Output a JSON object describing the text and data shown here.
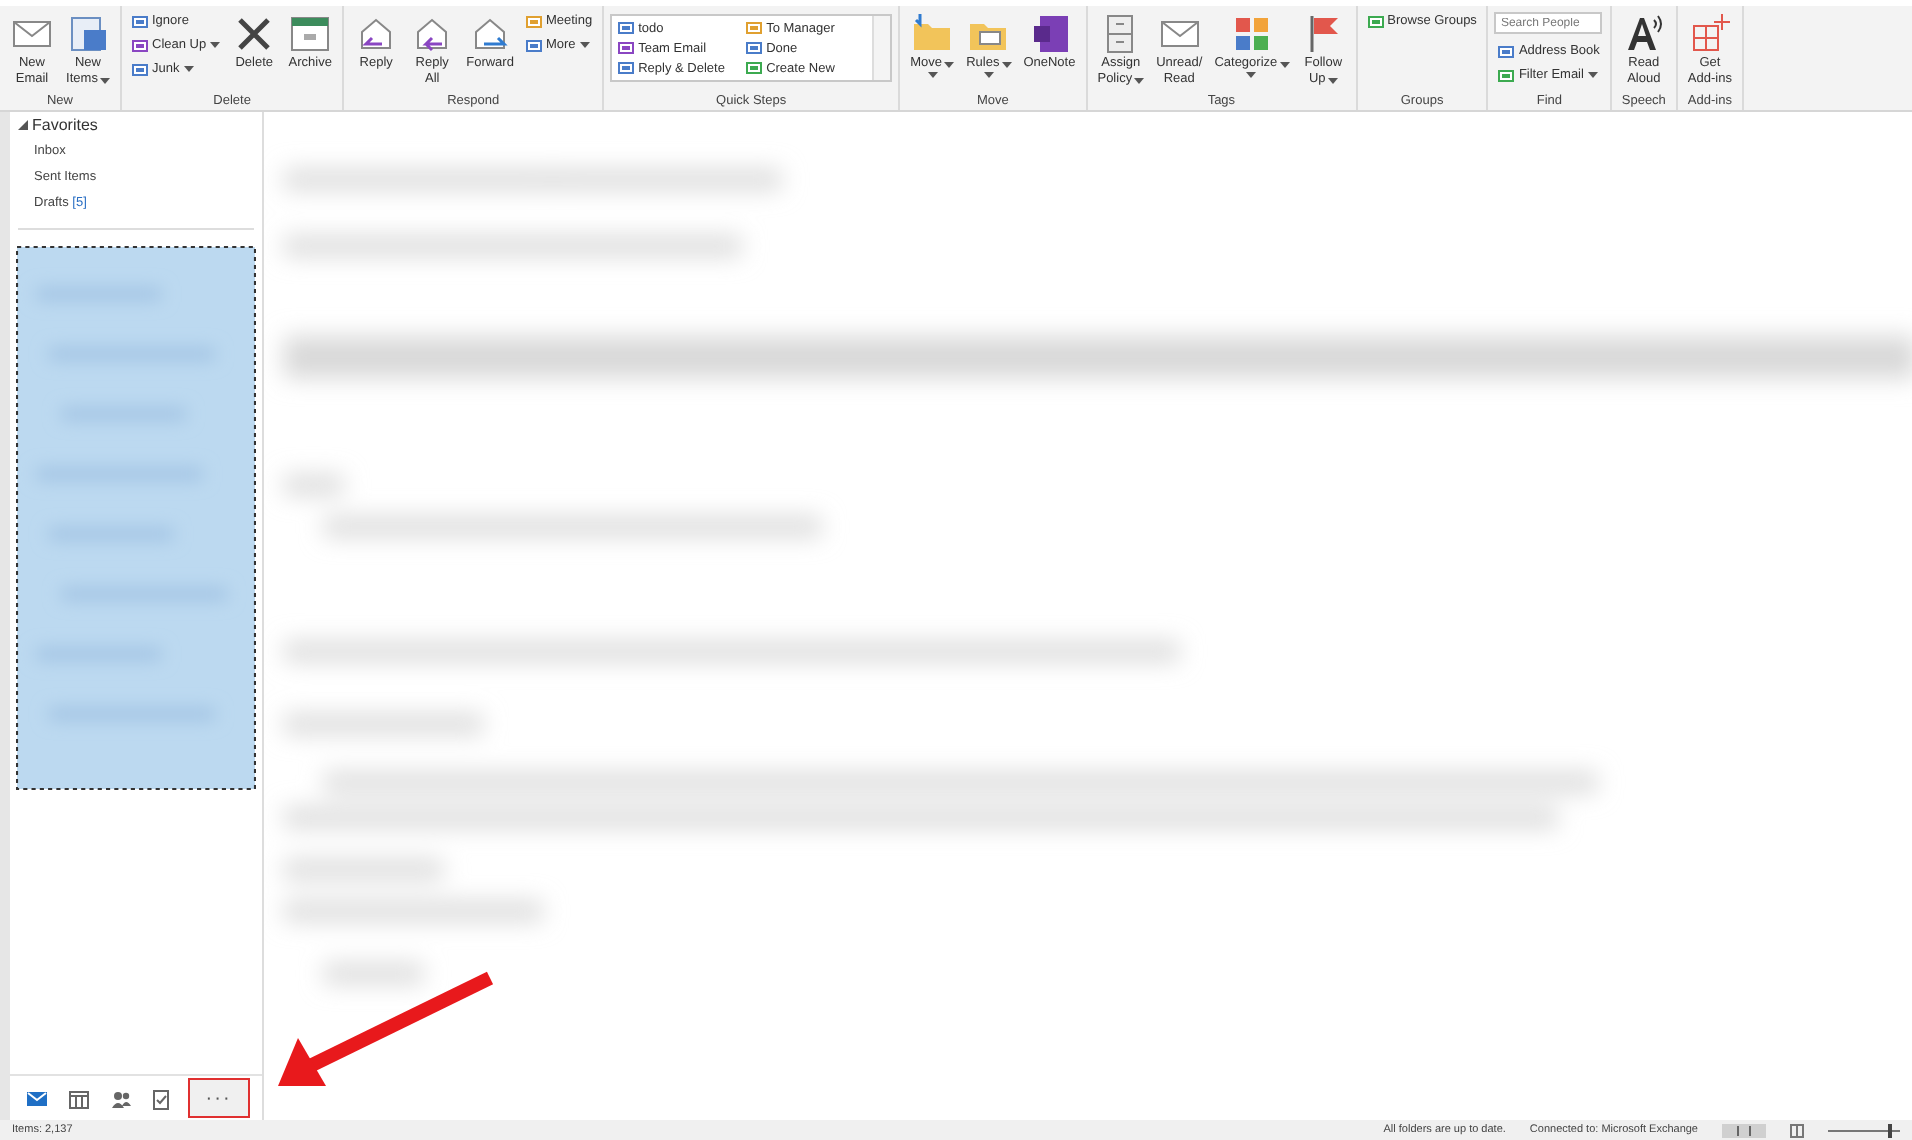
{
  "ribbon": {
    "groups": [
      {
        "label": "New",
        "items": [
          {
            "kind": "large",
            "lines": [
              "New",
              "Email"
            ],
            "dropdown": false
          },
          {
            "kind": "large",
            "lines": [
              "New",
              "Items"
            ],
            "dropdown": true
          }
        ]
      },
      {
        "label": "Delete",
        "items": [
          {
            "kind": "stack",
            "entries": [
              {
                "label": "Ignore",
                "dropdown": false
              },
              {
                "label": "Clean Up",
                "dropdown": true
              },
              {
                "label": "Junk",
                "dropdown": true
              }
            ]
          },
          {
            "kind": "large",
            "lines": [
              "Delete"
            ],
            "dropdown": false
          },
          {
            "kind": "large",
            "lines": [
              "Archive"
            ],
            "dropdown": false
          }
        ]
      },
      {
        "label": "Respond",
        "items": [
          {
            "kind": "large",
            "lines": [
              "Reply"
            ],
            "dropdown": false
          },
          {
            "kind": "large",
            "lines": [
              "Reply",
              "All"
            ],
            "dropdown": false
          },
          {
            "kind": "large",
            "lines": [
              "Forward"
            ],
            "dropdown": false
          },
          {
            "kind": "stack",
            "entries": [
              {
                "label": "Meeting",
                "dropdown": false
              },
              {
                "label": "More",
                "dropdown": true
              }
            ]
          }
        ]
      },
      {
        "label": "Quick Steps",
        "items": [
          {
            "kind": "quicksteps",
            "entries": [
              "todo",
              "Team Email",
              "Reply & Delete",
              "To Manager",
              "Done",
              "Create New"
            ]
          }
        ]
      },
      {
        "label": "Move",
        "items": [
          {
            "kind": "large",
            "lines": [
              "Move"
            ],
            "dropdown": true
          },
          {
            "kind": "large",
            "lines": [
              "Rules"
            ],
            "dropdown": true
          },
          {
            "kind": "large",
            "lines": [
              "OneNote"
            ],
            "dropdown": false
          }
        ]
      },
      {
        "label": "Tags",
        "items": [
          {
            "kind": "large",
            "lines": [
              "Assign",
              "Policy"
            ],
            "dropdown": true
          },
          {
            "kind": "large",
            "lines": [
              "Unread/",
              "Read"
            ],
            "dropdown": false
          },
          {
            "kind": "large",
            "lines": [
              "Categorize"
            ],
            "dropdown": true
          },
          {
            "kind": "large",
            "lines": [
              "Follow",
              "Up"
            ],
            "dropdown": true
          }
        ]
      },
      {
        "label": "Groups",
        "items": [
          {
            "kind": "stack",
            "entries": [
              {
                "label": "Browse Groups",
                "dropdown": false
              }
            ]
          }
        ]
      },
      {
        "label": "Find",
        "items": [
          {
            "kind": "find",
            "placeholder": "Search People",
            "entries": [
              {
                "label": "Address Book",
                "dropdown": false
              },
              {
                "label": "Filter Email",
                "dropdown": true
              }
            ]
          }
        ]
      },
      {
        "label": "Speech",
        "items": [
          {
            "kind": "large",
            "lines": [
              "Read",
              "Aloud"
            ],
            "dropdown": false
          }
        ]
      },
      {
        "label": "Add-ins",
        "items": [
          {
            "kind": "large",
            "lines": [
              "Get",
              "Add-ins"
            ],
            "dropdown": false
          }
        ]
      }
    ]
  },
  "favorites": {
    "label": "Favorites",
    "expanded": true,
    "items": [
      {
        "label": "Inbox"
      },
      {
        "label": "Sent Items"
      },
      {
        "label": "Drafts",
        "count": "[5]"
      }
    ]
  },
  "nav": [
    {
      "kind": "mail",
      "selected": true,
      "highlighted": false
    },
    {
      "kind": "calendar",
      "selected": false,
      "highlighted": false
    },
    {
      "kind": "people",
      "selected": false,
      "highlighted": false
    },
    {
      "kind": "tasks",
      "selected": false,
      "highlighted": false
    },
    {
      "kind": "more",
      "label": "···",
      "selected": false,
      "highlighted": true
    }
  ],
  "annotation": {
    "kind": "arrow"
  },
  "status_bar": {
    "items_count": "Items: 2,137",
    "sync": "All folders are up to date.",
    "connection": "Connected to: Microsoft Exchange",
    "zoom": {
      "level": 0.85
    }
  }
}
